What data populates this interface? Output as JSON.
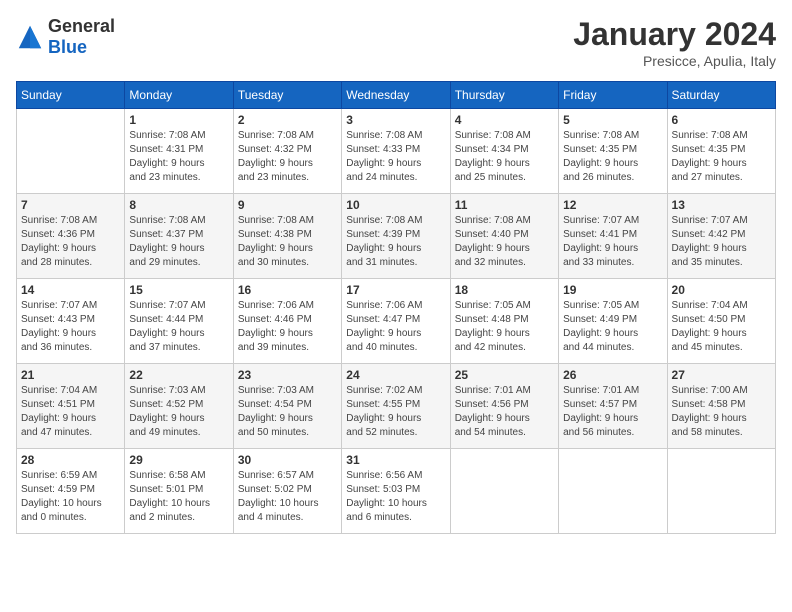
{
  "logo": {
    "general": "General",
    "blue": "Blue"
  },
  "header": {
    "month": "January 2024",
    "location": "Presicce, Apulia, Italy"
  },
  "weekdays": [
    "Sunday",
    "Monday",
    "Tuesday",
    "Wednesday",
    "Thursday",
    "Friday",
    "Saturday"
  ],
  "weeks": [
    [
      {
        "day": "",
        "info": ""
      },
      {
        "day": "1",
        "info": "Sunrise: 7:08 AM\nSunset: 4:31 PM\nDaylight: 9 hours\nand 23 minutes."
      },
      {
        "day": "2",
        "info": "Sunrise: 7:08 AM\nSunset: 4:32 PM\nDaylight: 9 hours\nand 23 minutes."
      },
      {
        "day": "3",
        "info": "Sunrise: 7:08 AM\nSunset: 4:33 PM\nDaylight: 9 hours\nand 24 minutes."
      },
      {
        "day": "4",
        "info": "Sunrise: 7:08 AM\nSunset: 4:34 PM\nDaylight: 9 hours\nand 25 minutes."
      },
      {
        "day": "5",
        "info": "Sunrise: 7:08 AM\nSunset: 4:35 PM\nDaylight: 9 hours\nand 26 minutes."
      },
      {
        "day": "6",
        "info": "Sunrise: 7:08 AM\nSunset: 4:35 PM\nDaylight: 9 hours\nand 27 minutes."
      }
    ],
    [
      {
        "day": "7",
        "info": "Sunrise: 7:08 AM\nSunset: 4:36 PM\nDaylight: 9 hours\nand 28 minutes."
      },
      {
        "day": "8",
        "info": "Sunrise: 7:08 AM\nSunset: 4:37 PM\nDaylight: 9 hours\nand 29 minutes."
      },
      {
        "day": "9",
        "info": "Sunrise: 7:08 AM\nSunset: 4:38 PM\nDaylight: 9 hours\nand 30 minutes."
      },
      {
        "day": "10",
        "info": "Sunrise: 7:08 AM\nSunset: 4:39 PM\nDaylight: 9 hours\nand 31 minutes."
      },
      {
        "day": "11",
        "info": "Sunrise: 7:08 AM\nSunset: 4:40 PM\nDaylight: 9 hours\nand 32 minutes."
      },
      {
        "day": "12",
        "info": "Sunrise: 7:07 AM\nSunset: 4:41 PM\nDaylight: 9 hours\nand 33 minutes."
      },
      {
        "day": "13",
        "info": "Sunrise: 7:07 AM\nSunset: 4:42 PM\nDaylight: 9 hours\nand 35 minutes."
      }
    ],
    [
      {
        "day": "14",
        "info": "Sunrise: 7:07 AM\nSunset: 4:43 PM\nDaylight: 9 hours\nand 36 minutes."
      },
      {
        "day": "15",
        "info": "Sunrise: 7:07 AM\nSunset: 4:44 PM\nDaylight: 9 hours\nand 37 minutes."
      },
      {
        "day": "16",
        "info": "Sunrise: 7:06 AM\nSunset: 4:46 PM\nDaylight: 9 hours\nand 39 minutes."
      },
      {
        "day": "17",
        "info": "Sunrise: 7:06 AM\nSunset: 4:47 PM\nDaylight: 9 hours\nand 40 minutes."
      },
      {
        "day": "18",
        "info": "Sunrise: 7:05 AM\nSunset: 4:48 PM\nDaylight: 9 hours\nand 42 minutes."
      },
      {
        "day": "19",
        "info": "Sunrise: 7:05 AM\nSunset: 4:49 PM\nDaylight: 9 hours\nand 44 minutes."
      },
      {
        "day": "20",
        "info": "Sunrise: 7:04 AM\nSunset: 4:50 PM\nDaylight: 9 hours\nand 45 minutes."
      }
    ],
    [
      {
        "day": "21",
        "info": "Sunrise: 7:04 AM\nSunset: 4:51 PM\nDaylight: 9 hours\nand 47 minutes."
      },
      {
        "day": "22",
        "info": "Sunrise: 7:03 AM\nSunset: 4:52 PM\nDaylight: 9 hours\nand 49 minutes."
      },
      {
        "day": "23",
        "info": "Sunrise: 7:03 AM\nSunset: 4:54 PM\nDaylight: 9 hours\nand 50 minutes."
      },
      {
        "day": "24",
        "info": "Sunrise: 7:02 AM\nSunset: 4:55 PM\nDaylight: 9 hours\nand 52 minutes."
      },
      {
        "day": "25",
        "info": "Sunrise: 7:01 AM\nSunset: 4:56 PM\nDaylight: 9 hours\nand 54 minutes."
      },
      {
        "day": "26",
        "info": "Sunrise: 7:01 AM\nSunset: 4:57 PM\nDaylight: 9 hours\nand 56 minutes."
      },
      {
        "day": "27",
        "info": "Sunrise: 7:00 AM\nSunset: 4:58 PM\nDaylight: 9 hours\nand 58 minutes."
      }
    ],
    [
      {
        "day": "28",
        "info": "Sunrise: 6:59 AM\nSunset: 4:59 PM\nDaylight: 10 hours\nand 0 minutes."
      },
      {
        "day": "29",
        "info": "Sunrise: 6:58 AM\nSunset: 5:01 PM\nDaylight: 10 hours\nand 2 minutes."
      },
      {
        "day": "30",
        "info": "Sunrise: 6:57 AM\nSunset: 5:02 PM\nDaylight: 10 hours\nand 4 minutes."
      },
      {
        "day": "31",
        "info": "Sunrise: 6:56 AM\nSunset: 5:03 PM\nDaylight: 10 hours\nand 6 minutes."
      },
      {
        "day": "",
        "info": ""
      },
      {
        "day": "",
        "info": ""
      },
      {
        "day": "",
        "info": ""
      }
    ]
  ]
}
